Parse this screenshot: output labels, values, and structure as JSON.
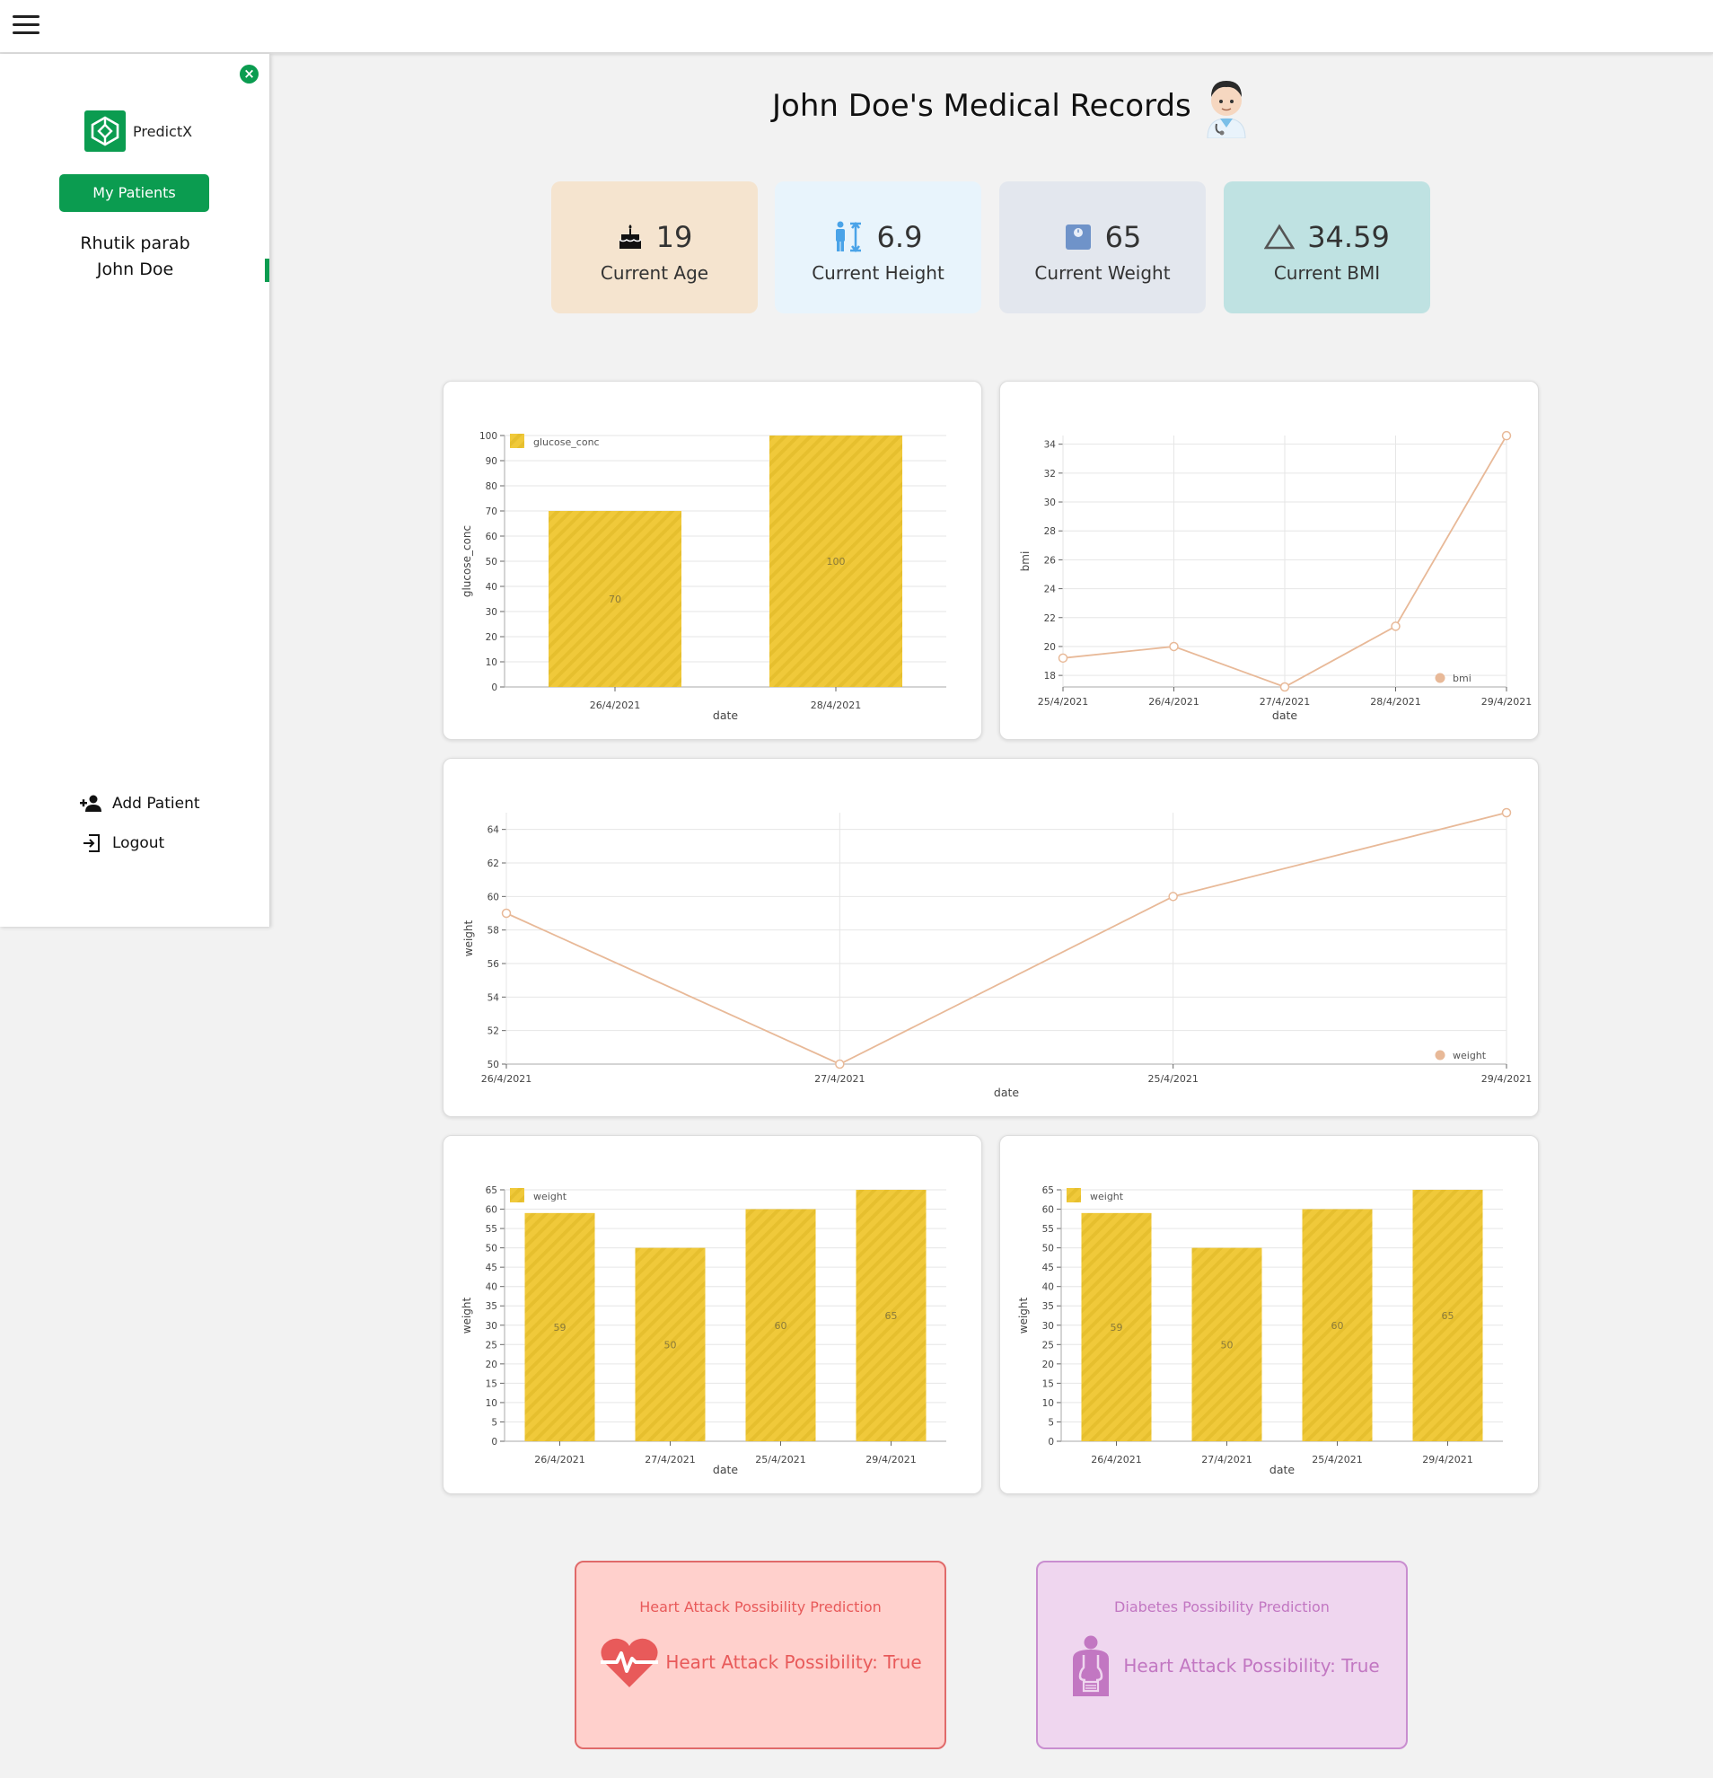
{
  "app": {
    "brand": "PredictX"
  },
  "sidebar": {
    "my_patients": "My Patients",
    "patients": [
      "Rhutik parab",
      "John Doe"
    ],
    "add_patient": "Add Patient",
    "logout": "Logout"
  },
  "page": {
    "title": "John Doe's Medical Records"
  },
  "stats": [
    {
      "value": "19",
      "label": "Current Age",
      "icon": "cake-icon",
      "bg": "#f5e4cf"
    },
    {
      "value": "6.9",
      "label": "Current Height",
      "icon": "height-icon",
      "bg": "#e8f4fc"
    },
    {
      "value": "65",
      "label": "Current Weight",
      "icon": "scale-icon",
      "bg": "#e3e7ee"
    },
    {
      "value": "34.59",
      "label": "Current BMI",
      "icon": "triangle-icon",
      "bg": "#bfe2e2"
    }
  ],
  "chart_data": [
    {
      "type": "bar",
      "categories": [
        "26/4/2021",
        "28/4/2021"
      ],
      "values": [
        70,
        100
      ],
      "series_name": "glucose_conc",
      "xlabel": "date",
      "ylabel": "glucose_conc",
      "ylim": [
        0,
        100
      ],
      "yticks": [
        0,
        10,
        20,
        30,
        40,
        50,
        60,
        70,
        80,
        90,
        100
      ],
      "legend": "top-left",
      "grid": true,
      "color": "#f0c93a"
    },
    {
      "type": "line",
      "categories": [
        "25/4/2021",
        "26/4/2021",
        "27/4/2021",
        "28/4/2021",
        "29/4/2021"
      ],
      "values": [
        19.2,
        20.0,
        17.2,
        21.4,
        34.59
      ],
      "series_name": "bmi",
      "xlabel": "date",
      "ylabel": "bmi",
      "ylim": [
        17.2,
        34.6
      ],
      "yticks": [
        18,
        20,
        22,
        24,
        26,
        28,
        30,
        32,
        34
      ],
      "legend": "bottom-right",
      "grid": true,
      "color": "#e8b998"
    },
    {
      "type": "line",
      "categories": [
        "26/4/2021",
        "27/4/2021",
        "25/4/2021",
        "29/4/2021"
      ],
      "values": [
        59,
        50,
        60,
        65
      ],
      "series_name": "weight",
      "xlabel": "date",
      "ylabel": "weight",
      "ylim": [
        50,
        65
      ],
      "yticks": [
        50,
        52,
        54,
        56,
        58,
        60,
        62,
        64
      ],
      "legend": "bottom-right",
      "grid": true,
      "color": "#e8b998"
    },
    {
      "type": "bar",
      "categories": [
        "26/4/2021",
        "27/4/2021",
        "25/4/2021",
        "29/4/2021"
      ],
      "values": [
        59,
        50,
        60,
        65
      ],
      "series_name": "weight",
      "xlabel": "date",
      "ylabel": "weight",
      "ylim": [
        0,
        65
      ],
      "yticks": [
        0,
        5,
        10,
        15,
        20,
        25,
        30,
        35,
        40,
        45,
        50,
        55,
        60,
        65
      ],
      "legend": "top-left",
      "grid": true,
      "color": "#f0c93a"
    },
    {
      "type": "bar",
      "categories": [
        "26/4/2021",
        "27/4/2021",
        "25/4/2021",
        "29/4/2021"
      ],
      "values": [
        59,
        50,
        60,
        65
      ],
      "series_name": "weight",
      "xlabel": "date",
      "ylabel": "weight",
      "ylim": [
        0,
        65
      ],
      "yticks": [
        0,
        5,
        10,
        15,
        20,
        25,
        30,
        35,
        40,
        45,
        50,
        55,
        60,
        65
      ],
      "legend": "top-left",
      "grid": true,
      "color": "#f0c93a"
    }
  ],
  "predictions": {
    "heart": {
      "title": "Heart Attack Possibility Prediction",
      "result": "Heart Attack Possibility: True",
      "icon": "heartbeat-icon",
      "color": "#e85a5a",
      "bg": "#ffd0cc",
      "border": "#e06a6a"
    },
    "diabetes": {
      "title": "Diabetes Possibility Prediction",
      "result": "Heart Attack Possibility: True",
      "icon": "organs-icon",
      "color": "#c277c2",
      "bg": "#efd6ef",
      "border": "#c98ed0"
    }
  }
}
